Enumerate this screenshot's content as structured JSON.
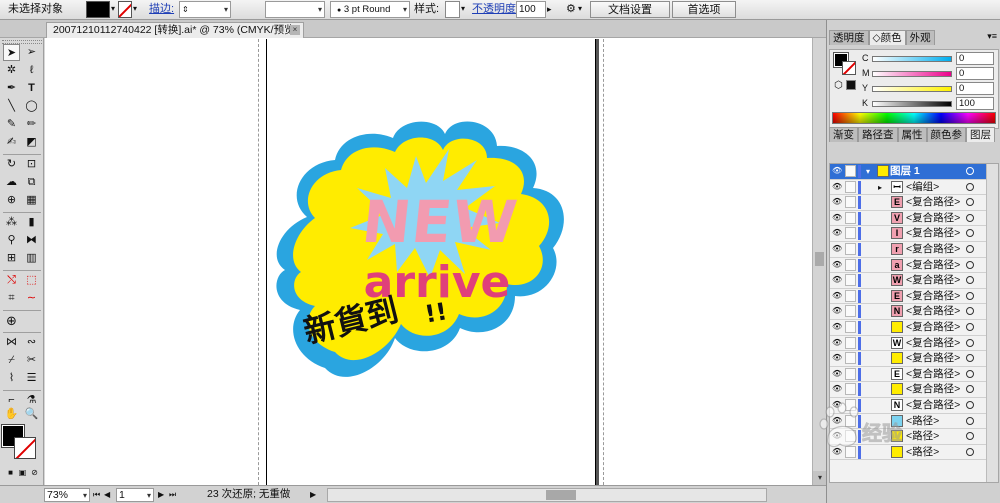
{
  "control_bar": {
    "selection_status": "未选择对象",
    "stroke_label": "描边:",
    "stroke_weight": "",
    "brush_value": "3 pt Round",
    "style_label": "样式:",
    "opacity_label": "不透明度:",
    "opacity_value": "100",
    "opacity_arrow": "▸",
    "doc_setup_button": "文档设置",
    "prefs_button": "首选项"
  },
  "document": {
    "tab_title": "20071210112740422 [转换].ai* @ 73% (CMYK/预览)",
    "close_glyph": "×"
  },
  "artwork": {
    "line1": "NEW",
    "line2": "arrive",
    "line3": "新貨到",
    "exclaim": "!!"
  },
  "status_bar": {
    "zoom": "73%",
    "page": "1",
    "history_text": "23 次还原; 无重做",
    "arrow": "▶"
  },
  "color_panel": {
    "tabs": [
      "透明度",
      "颜色",
      "外观"
    ],
    "active_tab": 1,
    "sliders": [
      {
        "label": "C",
        "value": "0"
      },
      {
        "label": "M",
        "value": "0"
      },
      {
        "label": "Y",
        "value": "0"
      },
      {
        "label": "K",
        "value": "100"
      }
    ]
  },
  "layers_panel": {
    "tabs": [
      "渐变",
      "路径查",
      "属性",
      "颜色参",
      "图层"
    ],
    "active_tab": 4,
    "rows": [
      {
        "name": "图层 1",
        "thumb_color": "#ffec00",
        "icon": "",
        "level": 0
      },
      {
        "name": "<编组>",
        "thumb_color": "#ffffff",
        "icon": "ꟷ",
        "level": 1
      },
      {
        "name": "<复合路径>",
        "thumb_color": "#f0a0b0",
        "icon": "E",
        "level": 2
      },
      {
        "name": "<复合路径>",
        "thumb_color": "#f0a0b0",
        "icon": "V",
        "level": 2
      },
      {
        "name": "<复合路径>",
        "thumb_color": "#f0a0b0",
        "icon": "I",
        "level": 2
      },
      {
        "name": "<复合路径>",
        "thumb_color": "#f0a0b0",
        "icon": "r",
        "level": 2
      },
      {
        "name": "<复合路径>",
        "thumb_color": "#f0a0b0",
        "icon": "a",
        "level": 2
      },
      {
        "name": "<复合路径>",
        "thumb_color": "#f0a0b0",
        "icon": "W",
        "level": 2
      },
      {
        "name": "<复合路径>",
        "thumb_color": "#f0a0b0",
        "icon": "E",
        "level": 2
      },
      {
        "name": "<复合路径>",
        "thumb_color": "#f0a0b0",
        "icon": "N",
        "level": 2
      },
      {
        "name": "<复合路径>",
        "thumb_color": "#ffec00",
        "icon": "",
        "level": 2
      },
      {
        "name": "<复合路径>",
        "thumb_color": "#ffffff",
        "icon": "W",
        "level": 2
      },
      {
        "name": "<复合路径>",
        "thumb_color": "#ffec00",
        "icon": "",
        "level": 2
      },
      {
        "name": "<复合路径>",
        "thumb_color": "#ffffff",
        "icon": "E",
        "level": 2
      },
      {
        "name": "<复合路径>",
        "thumb_color": "#ffec00",
        "icon": "",
        "level": 2
      },
      {
        "name": "<复合路径>",
        "thumb_color": "#ffffff",
        "icon": "N",
        "level": 2
      },
      {
        "name": "<路径>",
        "thumb_color": "#7dd3f0",
        "icon": "",
        "level": 2
      },
      {
        "name": "<路径>",
        "thumb_color": "#ffec00",
        "icon": "",
        "level": 2
      },
      {
        "name": "<路径>",
        "thumb_color": "#ffec00",
        "icon": "",
        "level": 2
      }
    ]
  },
  "colors": {
    "cloud_outer": "#2aa5e0",
    "cloud_inner": "#ffec00",
    "burst": "#8fd6f4",
    "new_fill": "#f29bb0",
    "arrive_fill": "#e0407a",
    "selection_blue": "#2f6fd5"
  },
  "icons": {
    "tools": [
      "selection-icon",
      "direct-select-icon",
      "magic-wand-icon",
      "lasso-icon",
      "pen-icon",
      "type-icon",
      "line-icon",
      "ellipse-icon",
      "paintbrush-icon",
      "pencil-icon",
      "blob-brush-icon",
      "eraser-icon",
      "rotate-icon",
      "scale-icon",
      "warp-icon",
      "free-transform-icon",
      "symbol-sprayer-icon",
      "graph-icon",
      "mesh-icon",
      "gradient-icon",
      "eyedropper-icon",
      "blend-icon",
      "live-paint-icon",
      "live-paint-select-icon",
      "crop-icon",
      "slice-icon",
      "hand-icon",
      "zoom-icon"
    ]
  }
}
